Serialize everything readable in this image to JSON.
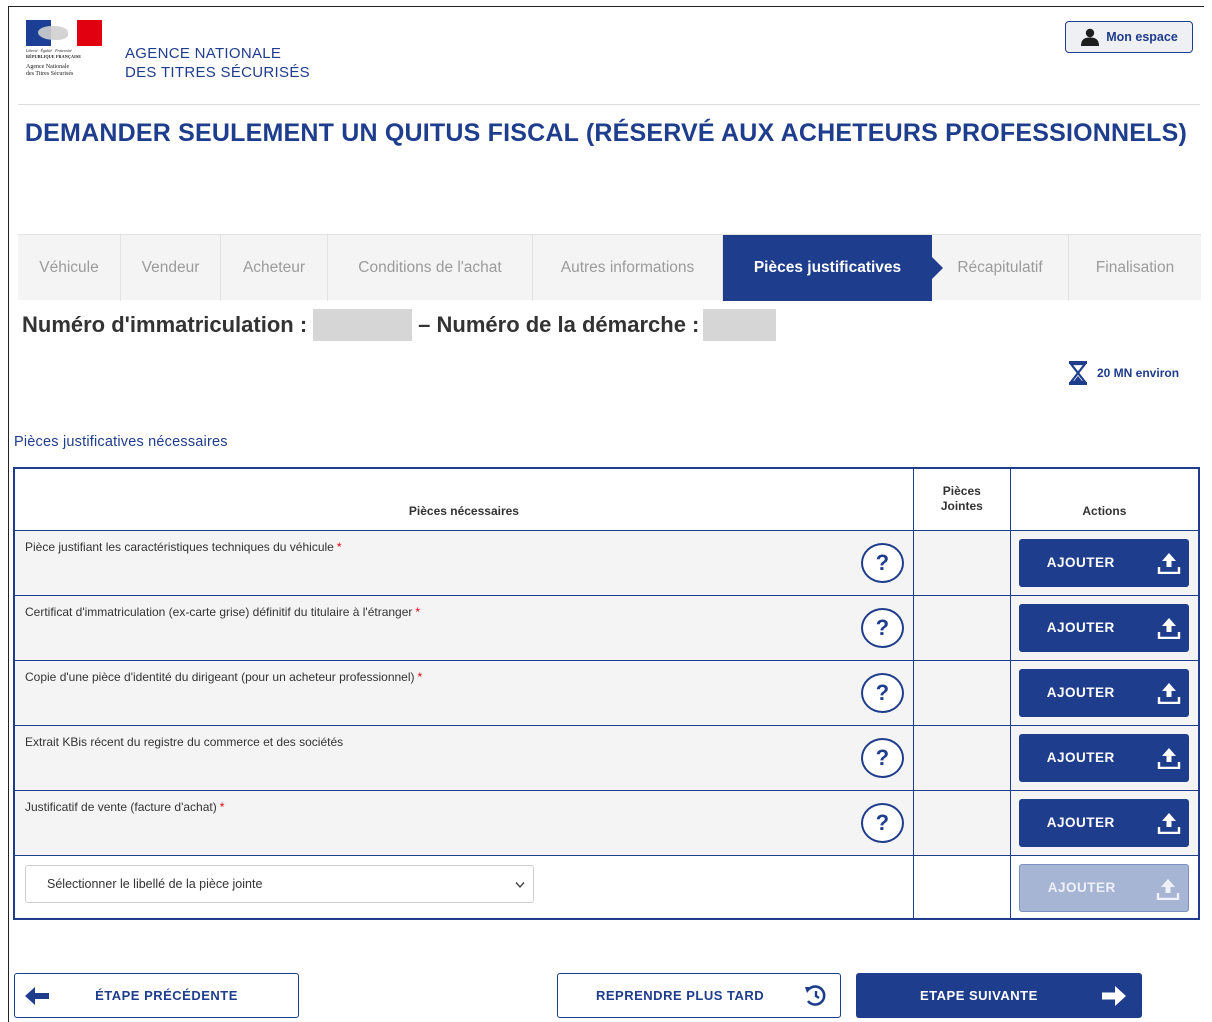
{
  "colors": {
    "primary": "#1f3d8d",
    "required": "#e1000f",
    "mask": "#d6d6d6"
  },
  "logo": {
    "line1": "Liberté · Égalité · Fraternité",
    "line2": "RÉPUBLIQUE FRANÇAISE",
    "line3": "Agence Nationale",
    "line4": "des Titres Sécurisés"
  },
  "header": {
    "agency_line1": "AGENCE NATIONALE",
    "agency_line2": "DES TITRES SÉCURISÉS",
    "account_button": "Mon espace",
    "account_icon": "user-icon"
  },
  "page_title": "DEMANDER SEULEMENT UN QUITUS FISCAL (RÉSERVÉ AUX ACHETEURS PROFESSIONNELS)",
  "tabs": [
    {
      "label": "Véhicule",
      "active": false
    },
    {
      "label": "Vendeur",
      "active": false
    },
    {
      "label": "Acheteur",
      "active": false
    },
    {
      "label": "Conditions de l'achat",
      "active": false
    },
    {
      "label": "Autres informations",
      "active": false
    },
    {
      "label": "Pièces justificatives",
      "active": true
    },
    {
      "label": "Récapitulatif",
      "active": false
    },
    {
      "label": "Finalisation",
      "active": false
    }
  ],
  "registration": {
    "immatriculation_label": "Numéro d'immatriculation :",
    "demarche_label": "– Numéro de la démarche :"
  },
  "duration": {
    "text": "20 MN environ",
    "icon": "hourglass-icon"
  },
  "section_title": "Pièces justificatives nécessaires",
  "table": {
    "headers": {
      "pieces": "Pièces nécessaires",
      "jointes_1": "Pièces",
      "jointes_2": "Jointes",
      "actions": "Actions"
    },
    "rows": [
      {
        "label": "Pièce justifiant les caractéristiques techniques du véhicule",
        "required": true,
        "action": "AJOUTER"
      },
      {
        "label": "Certificat d'immatriculation (ex-carte grise) définitif du titulaire à l'étranger",
        "required": true,
        "action": "AJOUTER"
      },
      {
        "label": "Copie d'une pièce d'identité du dirigeant (pour un acheteur professionnel)",
        "required": true,
        "action": "AJOUTER"
      },
      {
        "label": "Extrait KBis récent du registre du commerce et des sociétés",
        "required": false,
        "action": "AJOUTER"
      },
      {
        "label": "Justificatif de vente (facture d'achat)",
        "required": true,
        "action": "AJOUTER"
      }
    ],
    "help_symbol": "?",
    "required_mark": "*",
    "select_placeholder": "Sélectionner le libellé de la pièce jointe",
    "select_action": "AJOUTER"
  },
  "footer": {
    "prev": "ÉTAPE PRÉCÉDENTE",
    "later": "REPRENDRE PLUS TARD",
    "next": "ETAPE SUIVANTE"
  }
}
